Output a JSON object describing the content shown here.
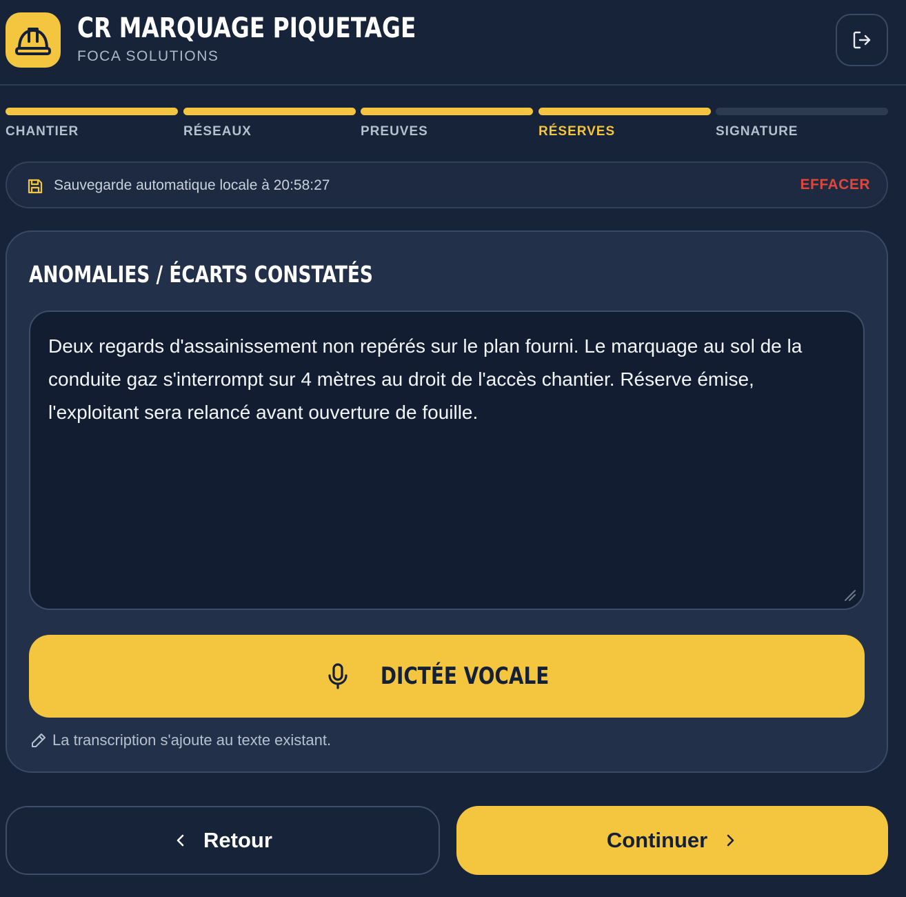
{
  "header": {
    "title": "CR MARQUAGE PIQUETAGE",
    "subtitle": "FOCA SOLUTIONS",
    "logo_icon": "hard-hat-icon",
    "logout_icon": "logout-icon"
  },
  "steps": [
    {
      "label": "CHANTIER",
      "state": "done"
    },
    {
      "label": "RÉSEAUX",
      "state": "done"
    },
    {
      "label": "PREUVES",
      "state": "done"
    },
    {
      "label": "RÉSERVES",
      "state": "active"
    },
    {
      "label": "SIGNATURE",
      "state": "pending"
    }
  ],
  "autosave": {
    "icon": "save-icon",
    "text": "Sauvegarde automatique locale à 20:58:27",
    "clear_label": "EFFACER"
  },
  "section": {
    "title": "ANOMALIES / ÉCARTS CONSTATÉS",
    "text_value": "Deux regards d'assainissement non repérés sur le plan fourni. Le marquage au sol de la conduite gaz s'interrompt sur 4 mètres au droit de l'accès chantier. Réserve émise, l'exploitant sera relancé avant ouverture de fouille.",
    "dictation_label": "DICTÉE VOCALE",
    "dictation_icon": "microphone-icon",
    "hint_icon": "pencil-icon",
    "hint": "La transcription s'ajoute au texte existant."
  },
  "navigation": {
    "back_label": "Retour",
    "next_label": "Continuer"
  },
  "colors": {
    "background": "#172339",
    "card": "#22304a",
    "accent": "#f4c53e",
    "danger": "#e0473b"
  }
}
